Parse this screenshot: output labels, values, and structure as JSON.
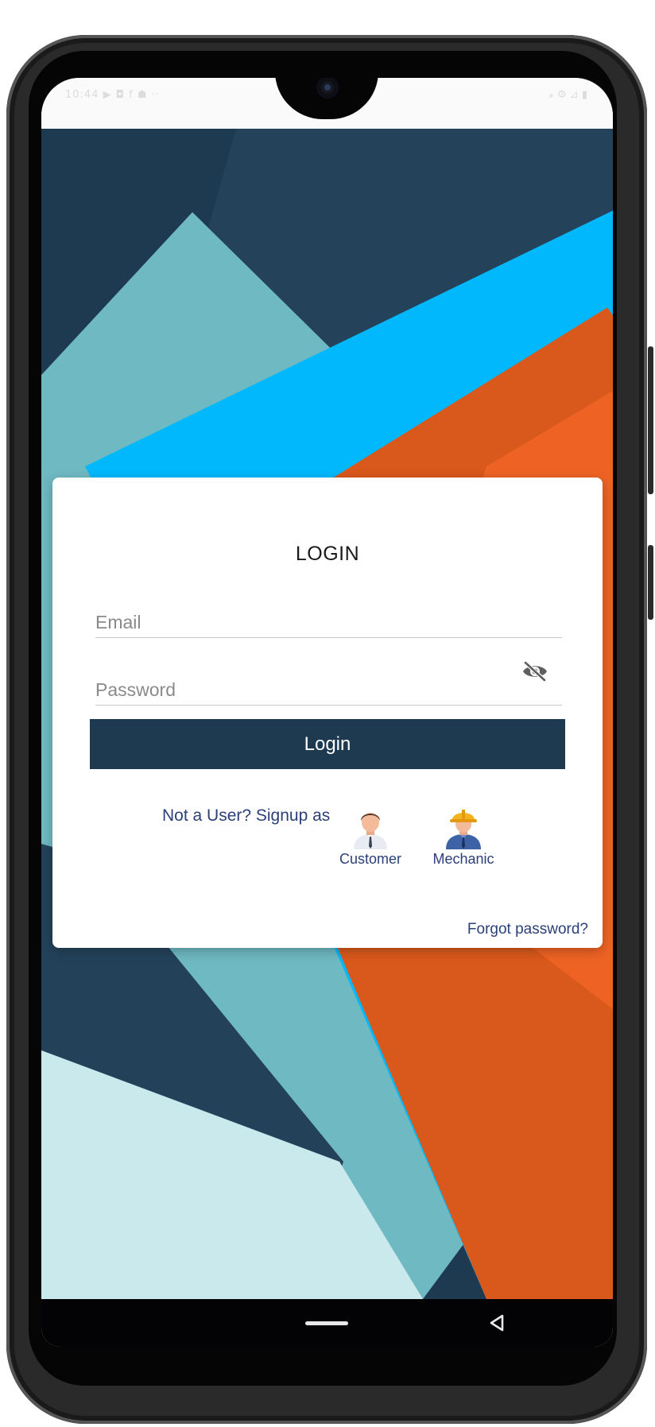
{
  "statusbar": {
    "left": "10:44 ▶ ◘ f ☗ ··",
    "right": "⁎ ⚙ ⊿ ▮"
  },
  "colors": {
    "primary": "#1e3a50",
    "link": "#2b3f7a",
    "bg_dark_navy": "#1d3a51",
    "bg_teal": "#6fb9c2",
    "bg_cyan": "#00b8fb",
    "bg_orange": "#d9581c",
    "bg_light": "#c9e9ed"
  },
  "login_card": {
    "title": "LOGIN",
    "email_placeholder": "Email",
    "password_placeholder": "Password",
    "password_toggle_icon": "eye-off-icon",
    "login_button": "Login",
    "signup_prompt": "Not a User? Signup as",
    "roles": [
      {
        "label": "Customer",
        "icon": "customer-avatar-icon"
      },
      {
        "label": "Mechanic",
        "icon": "mechanic-avatar-icon"
      }
    ],
    "forgot_password": "Forgot password?"
  },
  "navbar": {
    "home_icon": "home-pill-icon",
    "back_icon": "back-triangle-icon"
  }
}
